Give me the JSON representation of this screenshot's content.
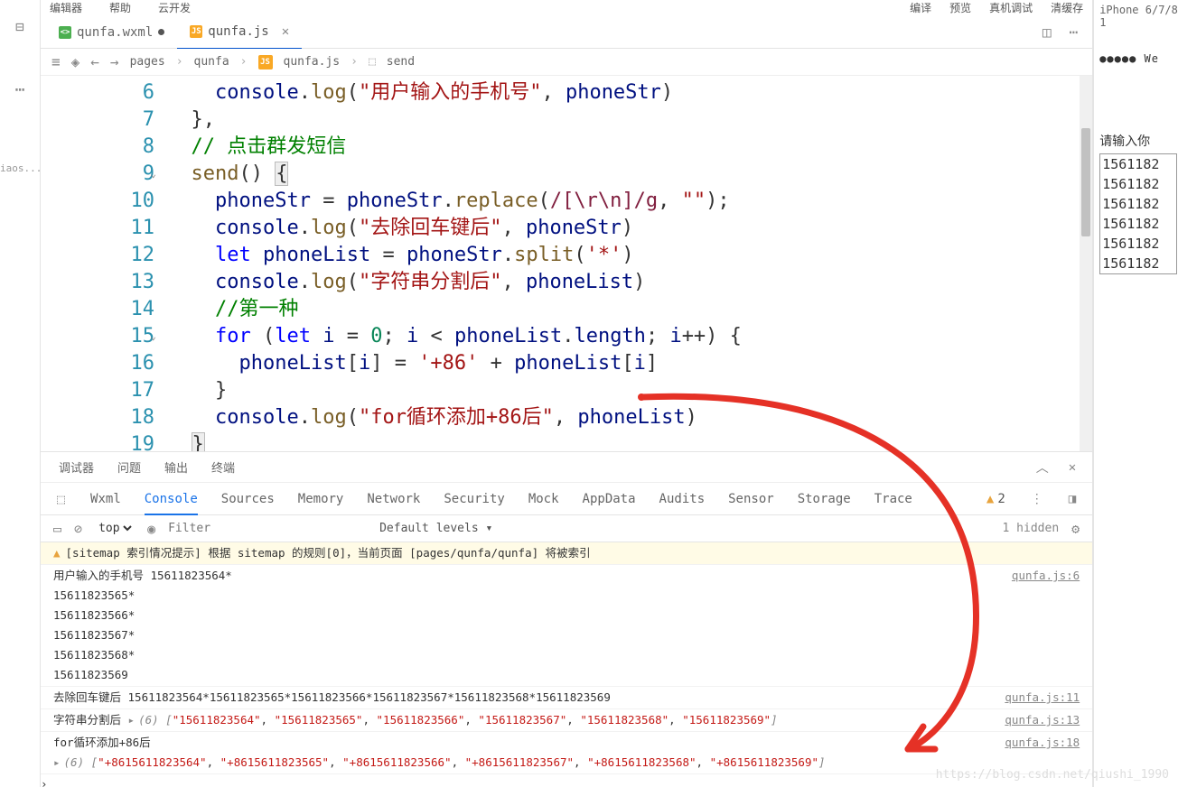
{
  "topmenu": {
    "left": [
      "编辑器",
      "帮助",
      "云开发"
    ],
    "right": [
      "编译",
      "预览",
      "真机调试",
      "清缓存"
    ]
  },
  "leftbar": {
    "more": "⋯",
    "text": "iaos..."
  },
  "tabs": [
    {
      "icon": "wxml",
      "label": "qunfa.wxml",
      "active": false,
      "dot": true
    },
    {
      "icon": "js",
      "label": "qunfa.js",
      "active": true,
      "close": true
    }
  ],
  "tabicons": {
    "split": "◫",
    "more": "⋯"
  },
  "crumb": {
    "icons": [
      "≡",
      "◈",
      "←",
      "→"
    ],
    "parts": [
      "pages",
      "qunfa",
      "qunfa.js",
      "send"
    ],
    "fileicon": "js",
    "cube": "⬚"
  },
  "code": {
    "start": 6,
    "lines": [
      {
        "n": 6,
        "html": "    <span class='tok-var'>console</span>.<span class='tok-fn'>log</span>(<span class='tok-str'>\"用户输入的手机号\"</span>, <span class='tok-var'>phoneStr</span>)"
      },
      {
        "n": 7,
        "html": "  },"
      },
      {
        "n": 8,
        "html": "  <span class='tok-com'>// 点击群发短信</span>"
      },
      {
        "n": 9,
        "fold": true,
        "html": "  <span class='tok-fn'>send</span>() <span class='hlbrace'>{</span>"
      },
      {
        "n": 10,
        "html": "    <span class='tok-var'>phoneStr</span> = <span class='tok-var'>phoneStr</span>.<span class='tok-fn'>replace</span>(<span class='tok-reg'>/[\\r\\n]/g</span>, <span class='tok-str'>\"\"</span>);"
      },
      {
        "n": 11,
        "html": "    <span class='tok-var'>console</span>.<span class='tok-fn'>log</span>(<span class='tok-str'>\"去除回车键后\"</span>, <span class='tok-var'>phoneStr</span>)"
      },
      {
        "n": 12,
        "html": "    <span class='tok-kw'>let</span> <span class='tok-var'>phoneList</span> = <span class='tok-var'>phoneStr</span>.<span class='tok-fn'>split</span>(<span class='tok-str'>'*'</span>)"
      },
      {
        "n": 13,
        "html": "    <span class='tok-var'>console</span>.<span class='tok-fn'>log</span>(<span class='tok-str'>\"字符串分割后\"</span>, <span class='tok-var'>phoneList</span>)"
      },
      {
        "n": 14,
        "html": "    <span class='tok-com'>//第一种</span>"
      },
      {
        "n": 15,
        "fold": true,
        "html": "    <span class='tok-kw'>for</span> (<span class='tok-kw'>let</span> <span class='tok-var'>i</span> = <span class='tok-num'>0</span>; <span class='tok-var'>i</span> &lt; <span class='tok-var'>phoneList</span>.<span class='tok-var'>length</span>; <span class='tok-var'>i</span>++) {"
      },
      {
        "n": 16,
        "html": "      <span class='tok-var'>phoneList</span>[<span class='tok-var'>i</span>] = <span class='tok-str'>'+86'</span> + <span class='tok-var'>phoneList</span>[<span class='tok-var'>i</span>]"
      },
      {
        "n": 17,
        "html": "    }"
      },
      {
        "n": 18,
        "html": "    <span class='tok-var'>console</span>.<span class='tok-fn'>log</span>(<span class='tok-str'>\"for循环添加+86后\"</span>, <span class='tok-var'>phoneList</span>)"
      },
      {
        "n": 19,
        "html": "  <span class='hlbrace'>}</span>"
      }
    ]
  },
  "panel_tabs": [
    "调试器",
    "问题",
    "输出",
    "终端"
  ],
  "dev_tabs": [
    "Wxml",
    "Console",
    "Sources",
    "Memory",
    "Network",
    "Security",
    "Mock",
    "AppData",
    "Audits",
    "Sensor",
    "Storage",
    "Trace"
  ],
  "dev_active": "Console",
  "warn_count": "2",
  "filter": {
    "scope": "top",
    "placeholder": "Filter",
    "levels": "Default levels ▾",
    "hidden": "1 hidden"
  },
  "console": [
    {
      "type": "warn",
      "msg": "[sitemap 索引情况提示] 根据 sitemap 的规则[0]，当前页面 [pages/qunfa/qunfa] 将被索引",
      "src": ""
    },
    {
      "type": "log",
      "msg": "用户输入的手机号 15611823564*\n15611823565*\n15611823566*\n15611823567*\n15611823568*\n15611823569",
      "src": "qunfa.js:6"
    },
    {
      "type": "log",
      "msg": "去除回车键后 15611823564*15611823565*15611823566*15611823567*15611823568*15611823569",
      "src": "qunfa.js:11"
    },
    {
      "type": "arr",
      "label": "字符串分割后",
      "count": "(6)",
      "items": [
        "\"15611823564\"",
        "\"15611823565\"",
        "\"15611823566\"",
        "\"15611823567\"",
        "\"15611823568\"",
        "\"15611823569\""
      ],
      "src": "qunfa.js:13"
    },
    {
      "type": "arr2",
      "label": "for循环添加+86后",
      "count": "(6)",
      "items": [
        "\"+8615611823564\"",
        "\"+8615611823565\"",
        "\"+8615611823566\"",
        "\"+8615611823567\"",
        "\"+8615611823568\"",
        "\"+8615611823569\""
      ],
      "src": "qunfa.js:18"
    }
  ],
  "phone": {
    "device": "iPhone 6/7/8 1",
    "dots": "●●●●● We",
    "prompt": "请输入你",
    "lines": [
      "1561182",
      "1561182",
      "1561182",
      "1561182",
      "1561182",
      "1561182"
    ]
  },
  "watermark": "https://blog.csdn.net/qiushi_1990"
}
